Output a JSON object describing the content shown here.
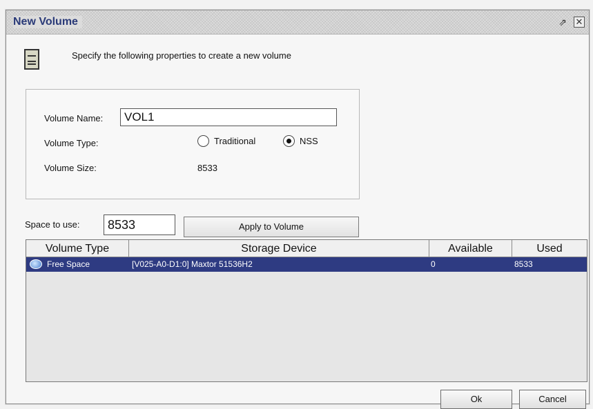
{
  "window": {
    "title": "New Volume",
    "restore_glyph": "⇗",
    "close_glyph": "✕"
  },
  "header": {
    "icon": "server-icon",
    "text": "Specify the following properties to create a new volume"
  },
  "properties": {
    "volume_name_label": "Volume Name:",
    "volume_name_value": "VOL1",
    "volume_type_label": "Volume Type:",
    "volume_type_options": [
      {
        "label": "Traditional",
        "selected": false
      },
      {
        "label": "NSS",
        "selected": true
      }
    ],
    "volume_size_label": "Volume Size:",
    "volume_size_value": "8533"
  },
  "space": {
    "label": "Space to use:",
    "value": "8533",
    "apply_label": "Apply to Volume"
  },
  "table": {
    "columns": [
      "Volume Type",
      "Storage Device",
      "Available",
      "Used"
    ],
    "rows": [
      {
        "icon": "disk-icon",
        "volume_type": "Free Space",
        "storage_device": "[V025-A0-D1:0] Maxtor 51536H2",
        "available": "0",
        "used": "8533",
        "selected": true
      }
    ]
  },
  "buttons": {
    "ok": "Ok",
    "cancel": "Cancel"
  },
  "colors": {
    "title_text": "#2a3a78",
    "selection": "#2e3b82"
  }
}
